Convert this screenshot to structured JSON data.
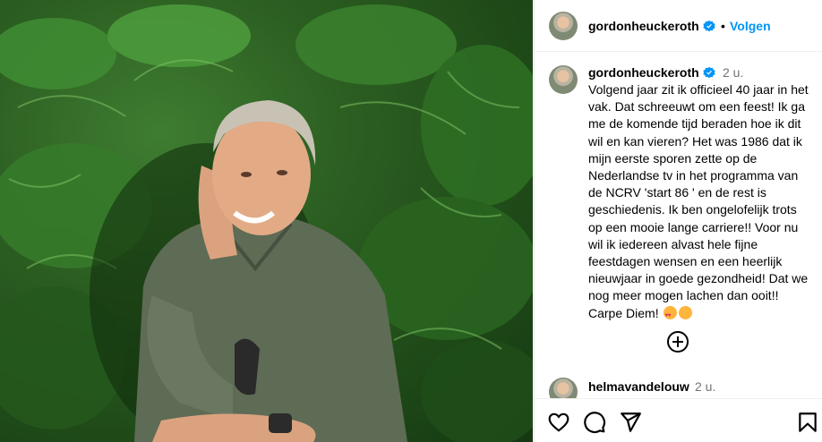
{
  "post": {
    "image_alt": "Man with grey curly hair in an olive green shirt, smiling and leaning his head on his hand in front of a wall of tropical plants"
  },
  "header": {
    "username": "gordonheuckeroth",
    "separator": "•",
    "follow_label": "Volgen"
  },
  "caption": {
    "username": "gordonheuckeroth",
    "time": "2 u.",
    "text": "Volgend jaar zit ik officieel 40 jaar in het vak. Dat schreeuwt om een feest! Ik ga me de komende tijd beraden hoe ik dit wil en kan vieren? Het was 1986 dat ik mijn eerste sporen zette op de Nederlandse tv in het programma van de NCRV 'start 86 ' en de rest is geschiedenis. Ik ben ongelofelijk trots op een mooie lange carriere!! Voor nu wil ik iedereen alvast hele fijne feestdagen wensen en een heerlijk nieuwjaar in goede gezondheid! Dat we nog meer mogen lachen dan ooit!! Carpe Diem! "
  },
  "comment": {
    "username": "helmavandelouw",
    "time": "2 u."
  },
  "icons": {
    "like": "heart-icon",
    "comment": "comment-icon",
    "share": "share-icon",
    "save": "bookmark-icon",
    "verified": "verified-badge-icon",
    "add": "add-circle-icon"
  },
  "colors": {
    "follow": "#0095f6",
    "verified": "#0095f6",
    "muted": "#737373"
  }
}
